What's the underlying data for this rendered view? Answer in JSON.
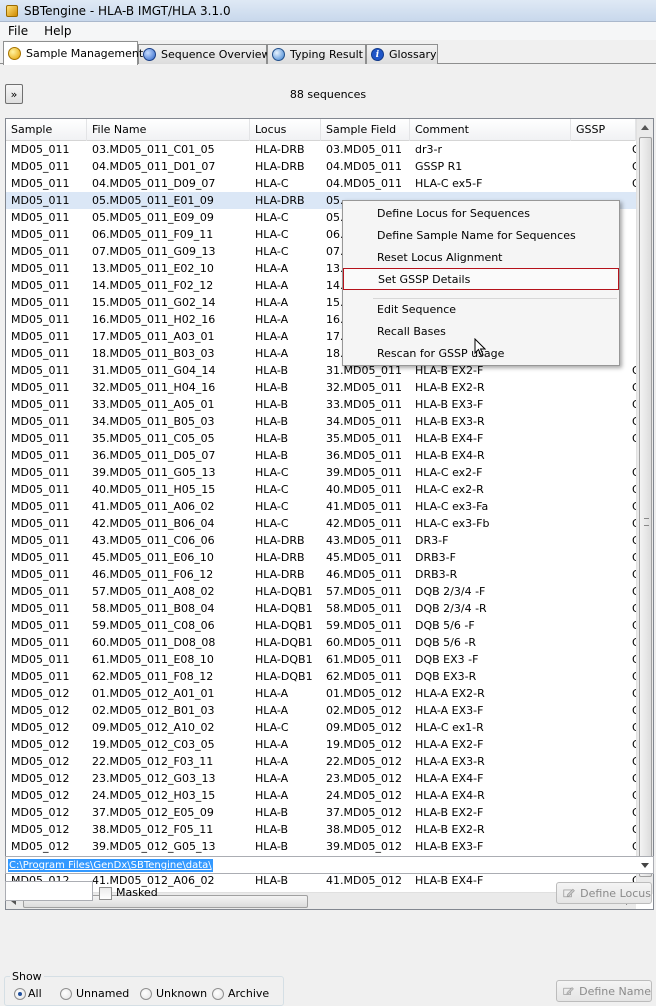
{
  "window": {
    "title": "SBTengine - HLA-B IMGT/HLA 3.1.0"
  },
  "menu": [
    "File",
    "Help"
  ],
  "tabs": [
    {
      "label": "Sample Management",
      "icon": "sample-icon",
      "active": true
    },
    {
      "label": "Sequence Overview",
      "icon": "sequence-icon",
      "active": false
    },
    {
      "label": "Typing Result",
      "icon": "globe-icon",
      "active": false
    },
    {
      "label": "Glossary",
      "icon": "info-icon",
      "active": false
    }
  ],
  "toolbar": {
    "expand_label": "»",
    "sequence_count": "88 sequences"
  },
  "table": {
    "columns": [
      "Sample",
      "File Name",
      "Locus",
      "Sample Field",
      "Comment",
      "GSSP"
    ],
    "selected_row": 3,
    "rows": [
      [
        "MD05_011",
        "03.MD05_011_C01_05",
        "HLA-DRB",
        "03.MD05_011",
        "dr3-r",
        "G"
      ],
      [
        "MD05_011",
        "04.MD05_011_D01_07",
        "HLA-DRB",
        "04.MD05_011",
        "GSSP R1",
        "G"
      ],
      [
        "MD05_011",
        "04.MD05_011_D09_07",
        "HLA-C",
        "04.MD05_011",
        "HLA-C ex5-F",
        "G"
      ],
      [
        "MD05_011",
        "05.MD05_011_E01_09",
        "HLA-DRB",
        "05.",
        "",
        ""
      ],
      [
        "MD05_011",
        "05.MD05_011_E09_09",
        "HLA-C",
        "05.",
        "",
        ""
      ],
      [
        "MD05_011",
        "06.MD05_011_F09_11",
        "HLA-C",
        "06.",
        "",
        ""
      ],
      [
        "MD05_011",
        "07.MD05_011_G09_13",
        "HLA-C",
        "07.",
        "",
        ""
      ],
      [
        "MD05_011",
        "13.MD05_011_E02_10",
        "HLA-A",
        "13.",
        "",
        ""
      ],
      [
        "MD05_011",
        "14.MD05_011_F02_12",
        "HLA-A",
        "14.",
        "",
        ""
      ],
      [
        "MD05_011",
        "15.MD05_011_G02_14",
        "HLA-A",
        "15.",
        "",
        ""
      ],
      [
        "MD05_011",
        "16.MD05_011_H02_16",
        "HLA-A",
        "16.",
        "",
        ""
      ],
      [
        "MD05_011",
        "17.MD05_011_A03_01",
        "HLA-A",
        "17.",
        "",
        ""
      ],
      [
        "MD05_011",
        "18.MD05_011_B03_03",
        "HLA-A",
        "18.",
        "",
        ""
      ],
      [
        "MD05_011",
        "31.MD05_011_G04_14",
        "HLA-B",
        "31.MD05_011",
        "HLA-B EX2-F",
        "G"
      ],
      [
        "MD05_011",
        "32.MD05_011_H04_16",
        "HLA-B",
        "32.MD05_011",
        "HLA-B EX2-R",
        "G"
      ],
      [
        "MD05_011",
        "33.MD05_011_A05_01",
        "HLA-B",
        "33.MD05_011",
        "HLA-B EX3-F",
        "G"
      ],
      [
        "MD05_011",
        "34.MD05_011_B05_03",
        "HLA-B",
        "34.MD05_011",
        "HLA-B EX3-R",
        "G"
      ],
      [
        "MD05_011",
        "35.MD05_011_C05_05",
        "HLA-B",
        "35.MD05_011",
        "HLA-B EX4-F",
        "G"
      ],
      [
        "MD05_011",
        "36.MD05_011_D05_07",
        "HLA-B",
        "36.MD05_011",
        "HLA-B EX4-R",
        ""
      ],
      [
        "MD05_011",
        "39.MD05_011_G05_13",
        "HLA-C",
        "39.MD05_011",
        "HLA-C ex2-F",
        "G"
      ],
      [
        "MD05_011",
        "40.MD05_011_H05_15",
        "HLA-C",
        "40.MD05_011",
        "HLA-C ex2-R",
        "G"
      ],
      [
        "MD05_011",
        "41.MD05_011_A06_02",
        "HLA-C",
        "41.MD05_011",
        "HLA-C ex3-Fa",
        "G"
      ],
      [
        "MD05_011",
        "42.MD05_011_B06_04",
        "HLA-C",
        "42.MD05_011",
        "HLA-C ex3-Fb",
        "G"
      ],
      [
        "MD05_011",
        "43.MD05_011_C06_06",
        "HLA-DRB",
        "43.MD05_011",
        "DR3-F",
        "G"
      ],
      [
        "MD05_011",
        "45.MD05_011_E06_10",
        "HLA-DRB",
        "45.MD05_011",
        "DRB3-F",
        "G"
      ],
      [
        "MD05_011",
        "46.MD05_011_F06_12",
        "HLA-DRB",
        "46.MD05_011",
        "DRB3-R",
        "G"
      ],
      [
        "MD05_011",
        "57.MD05_011_A08_02",
        "HLA-DQB1",
        "57.MD05_011",
        "DQB 2/3/4  -F",
        "G"
      ],
      [
        "MD05_011",
        "58.MD05_011_B08_04",
        "HLA-DQB1",
        "58.MD05_011",
        "DQB 2/3/4  -R",
        "G"
      ],
      [
        "MD05_011",
        "59.MD05_011_C08_06",
        "HLA-DQB1",
        "59.MD05_011",
        "DQB 5/6  -F",
        "G"
      ],
      [
        "MD05_011",
        "60.MD05_011_D08_08",
        "HLA-DQB1",
        "60.MD05_011",
        "DQB 5/6  -R",
        "G"
      ],
      [
        "MD05_011",
        "61.MD05_011_E08_10",
        "HLA-DQB1",
        "61.MD05_011",
        "DQB EX3  -F",
        "G"
      ],
      [
        "MD05_011",
        "62.MD05_011_F08_12",
        "HLA-DQB1",
        "62.MD05_011",
        "DQB EX3-R",
        "G"
      ],
      [
        "MD05_012",
        "01.MD05_012_A01_01",
        "HLA-A",
        "01.MD05_012",
        "HLA-A EX2-R",
        "G"
      ],
      [
        "MD05_012",
        "02.MD05_012_B01_03",
        "HLA-A",
        "02.MD05_012",
        "HLA-A EX3-F",
        "G"
      ],
      [
        "MD05_012",
        "09.MD05_012_A10_02",
        "HLA-C",
        "09.MD05_012",
        "HLA-C ex1-R",
        "G"
      ],
      [
        "MD05_012",
        "19.MD05_012_C03_05",
        "HLA-A",
        "19.MD05_012",
        "HLA-A EX2-F",
        "G"
      ],
      [
        "MD05_012",
        "22.MD05_012_F03_11",
        "HLA-A",
        "22.MD05_012",
        "HLA-A EX3-R",
        "G"
      ],
      [
        "MD05_012",
        "23.MD05_012_G03_13",
        "HLA-A",
        "23.MD05_012",
        "HLA-A EX4-F",
        "G"
      ],
      [
        "MD05_012",
        "24.MD05_012_H03_15",
        "HLA-A",
        "24.MD05_012",
        "HLA-A EX4-R",
        "G"
      ],
      [
        "MD05_012",
        "37.MD05_012_E05_09",
        "HLA-B",
        "37.MD05_012",
        "HLA-B EX2-F",
        "G"
      ],
      [
        "MD05_012",
        "38.MD05_012_F05_11",
        "HLA-B",
        "38.MD05_012",
        "HLA-B EX2-R",
        "G"
      ],
      [
        "MD05_012",
        "39.MD05_012_G05_13",
        "HLA-B",
        "39.MD05_012",
        "HLA-B EX3-F",
        "G"
      ],
      [
        "MD05_012",
        "40.MD05_012_H05_15",
        "HLA-B",
        "40.MD05_012",
        "HLA-B EX3-R",
        "G"
      ],
      [
        "MD05_012",
        "41.MD05_012_A06_02",
        "HLA-B",
        "41.MD05_012",
        "HLA-B EX4-F",
        "G"
      ]
    ]
  },
  "context_menu": {
    "items": [
      "Define Locus for Sequences",
      "Define Sample Name for Sequences",
      "Reset Locus Alignment",
      "Set GSSP Details",
      "Edit Sequence",
      "Recall Bases",
      "Rescan for GSSP usage"
    ],
    "highlighted": 3
  },
  "path": {
    "value": "C:\\Program Files\\GenDx\\SBTengine\\data\\"
  },
  "filter": {
    "value": "",
    "masked_label": "Masked",
    "masked_checked": false
  },
  "buttons": {
    "define_locus": "Define Locus",
    "define_name": "Define Name"
  },
  "show_group": {
    "title": "Show",
    "options": [
      "All",
      "Unnamed",
      "Unknown",
      "Archive"
    ],
    "selected": 0
  },
  "colors": {
    "selection": "#dbe7f6",
    "highlight_border": "#b5121b",
    "path_selection": "#3399ff"
  }
}
